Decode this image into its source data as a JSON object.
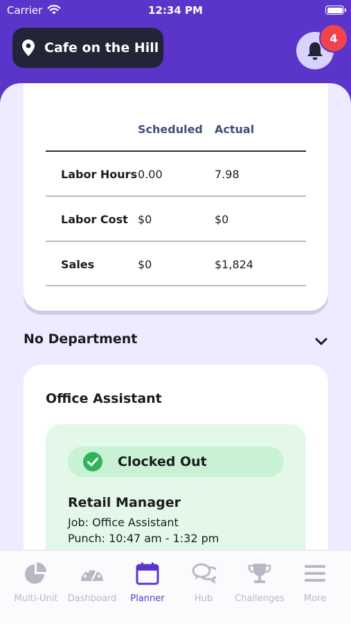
{
  "status_bar": {
    "carrier": "Carrier",
    "time": "12:34 PM"
  },
  "header": {
    "location": "Cafe on the Hill",
    "notification_count": "4"
  },
  "summary": {
    "columns": [
      "Scheduled",
      "Actual"
    ],
    "rows": [
      {
        "label": "Labor Hours",
        "scheduled": "0.00",
        "actual": "7.98"
      },
      {
        "label": "Labor Cost",
        "scheduled": "$0",
        "actual": "$0"
      },
      {
        "label": "Sales",
        "scheduled": "$0",
        "actual": "$1,824"
      }
    ]
  },
  "department": {
    "label": "No Department"
  },
  "shift": {
    "role": "Office Assistant",
    "status": "Clocked Out",
    "employee_title": "Retail Manager",
    "job": "Job: Office Assistant",
    "punch": "Punch: 10:47 am - 1:32 pm"
  },
  "tabs": [
    {
      "label": "Multi-Unit",
      "icon": "pie-chart-icon"
    },
    {
      "label": "Dashboard",
      "icon": "gauge-icon"
    },
    {
      "label": "Planner",
      "icon": "calendar-icon"
    },
    {
      "label": "Hub",
      "icon": "chat-bubbles-icon"
    },
    {
      "label": "Challenges",
      "icon": "trophy-icon"
    },
    {
      "label": "More",
      "icon": "menu-icon"
    }
  ],
  "active_tab": "Planner",
  "colors": {
    "brand": "#5b34c9",
    "sheet_background": "#ecebff",
    "badge": "#f0434e",
    "status_green": "#2fb45a",
    "inactive_tab": "#b8b8c4"
  }
}
